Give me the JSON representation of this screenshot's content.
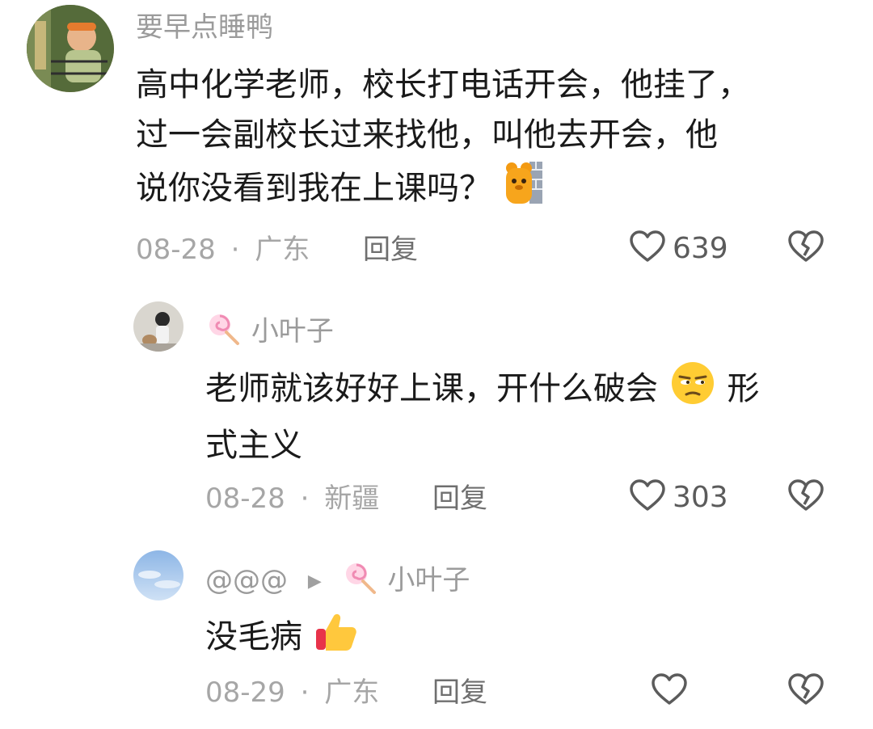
{
  "comments": [
    {
      "username": "要早点睡鸭",
      "text_lines": [
        "高中化学老师，校长打电话开会，他挂了，",
        "过一会副校长过来找他，叫他去开会，他",
        "说你没看到我在上课吗？"
      ],
      "date": "08-28",
      "location": "广东",
      "reply_label": "回复",
      "likes": "639",
      "avatar_icon": "child-avatar",
      "emoji_icon": "bear-peeking-wall-emoji"
    },
    {
      "username": "小叶子",
      "username_icon": "lollipop-icon",
      "text_lines": [
        "老师就该好好上课，开什么破会",
        "式主义"
      ],
      "text_tail": "形",
      "date": "08-28",
      "location": "新疆",
      "reply_label": "回复",
      "likes": "303",
      "avatar_icon": "woman-with-dog-avatar",
      "emoji_icon": "unamused-face-emoji"
    },
    {
      "username": "@@@",
      "reply_to": "小叶子",
      "username_icon": "lollipop-icon",
      "text_lines": [
        "没毛病"
      ],
      "date": "08-29",
      "location": "广东",
      "reply_label": "回复",
      "avatar_icon": "sky-avatar",
      "emoji_icon": "thumbs-up-emoji"
    }
  ],
  "meta_separator": "·",
  "colors": {
    "text": "#1a1a1a",
    "muted": "#a6a6a6",
    "username": "#9b9b9b",
    "icon": "#5b5b5b"
  }
}
